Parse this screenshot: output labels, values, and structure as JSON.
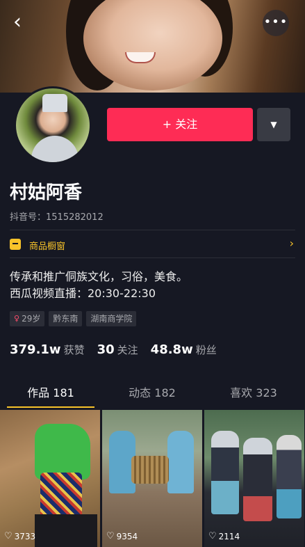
{
  "header": {
    "back_icon": "chevron-left-icon",
    "more_icon": "more-dots-icon"
  },
  "profile": {
    "name": "村姑阿香",
    "douyin_id": "抖音号：1515282012",
    "follow_label": "+ 关注",
    "dropdown_icon": "caret-down-icon"
  },
  "shop": {
    "label": "商品橱窗",
    "arrow": "›"
  },
  "bio": {
    "line1": "传承和推广侗族文化，习俗，美食。",
    "line2": "西瓜视频直播：20:30-22:30"
  },
  "tags": [
    {
      "gender_icon": "female-icon",
      "text": "29岁"
    },
    {
      "text": "黔东南"
    },
    {
      "text": "湖南商学院"
    }
  ],
  "stats": [
    {
      "num": "379.1w",
      "label": "获赞"
    },
    {
      "num": "30",
      "label": "关注"
    },
    {
      "num": "48.8w",
      "label": "粉丝"
    }
  ],
  "tabs": [
    {
      "label": "作品 181",
      "active": true
    },
    {
      "label": "动态 182",
      "active": false
    },
    {
      "label": "喜欢 323",
      "active": false
    }
  ],
  "videos": [
    {
      "likes": "3733"
    },
    {
      "likes": "9354"
    },
    {
      "likes": "2114"
    }
  ],
  "colors": {
    "accent": "#fe2c55",
    "highlight": "#f8c32a",
    "background": "#161823"
  }
}
